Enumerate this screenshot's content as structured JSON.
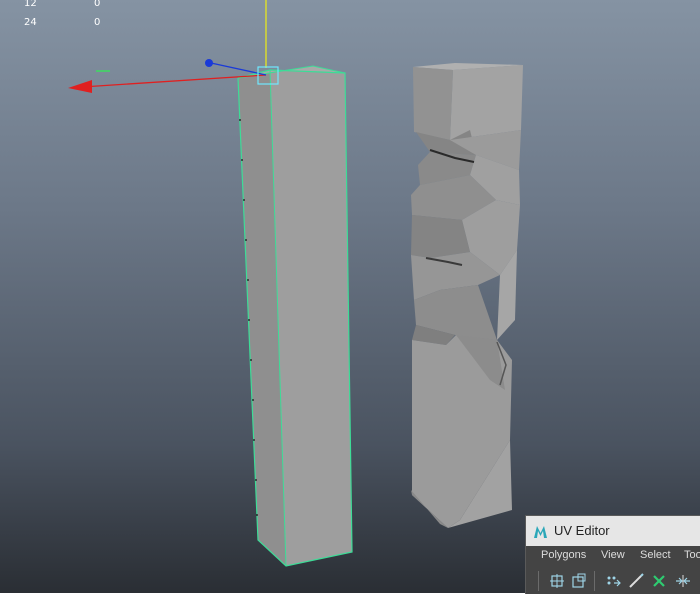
{
  "hud": {
    "row1_label": "12",
    "row1_value": "0",
    "row2_label": "24",
    "row2_value": "0"
  },
  "colors": {
    "viewport_top": "#8593a3",
    "viewport_bottom": "#2a2e34",
    "selection_wire": "#3ddc97",
    "axis_x": "#e02020",
    "axis_y": "#e6e61e",
    "axis_z": "#1a3ad8",
    "panel_bg": "#444444",
    "title_bg": "#e6e6e6"
  },
  "uv_editor": {
    "title": "UV Editor",
    "menus": [
      "Polygons",
      "View",
      "Select",
      "Too"
    ],
    "toolbar_icons": [
      "uv-grid-icon",
      "uv-snap-icon",
      "uv-move-icon",
      "uv-cut-icon",
      "uv-sew-icon",
      "uv-unfold-icon"
    ]
  },
  "scene_objects": [
    "selected-box-column",
    "fractured-column"
  ]
}
